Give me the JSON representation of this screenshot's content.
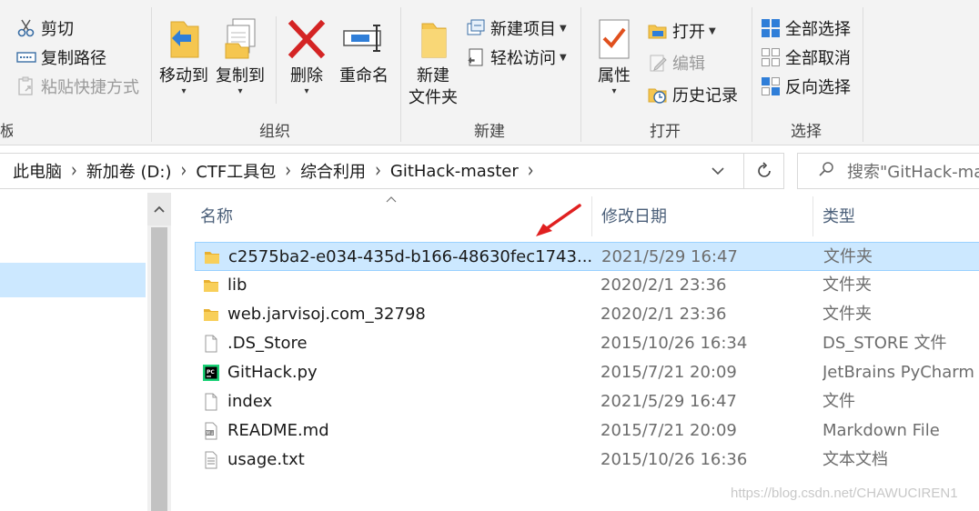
{
  "ribbon": {
    "clipboard_group": {
      "label_partial": "板",
      "cut": "剪切",
      "copy_path": "复制路径",
      "paste_shortcut": "粘贴快捷方式"
    },
    "organize_group": {
      "label": "组织",
      "move_to": "移动到",
      "copy_to": "复制到",
      "delete": "删除",
      "rename": "重命名"
    },
    "new_group": {
      "label": "新建",
      "new_folder_line1": "新建",
      "new_folder_line2": "文件夹",
      "new_item": "新建项目",
      "easy_access": "轻松访问"
    },
    "open_group": {
      "label": "打开",
      "properties": "属性",
      "open": "打开",
      "edit": "编辑",
      "history": "历史记录"
    },
    "select_group": {
      "label": "选择",
      "select_all": "全部选择",
      "select_none": "全部取消",
      "invert_selection": "反向选择"
    }
  },
  "address": {
    "crumbs": [
      "此电脑",
      "新加卷 (D:)",
      "CTF工具包",
      "综合利用",
      "GitHack-master"
    ],
    "search_placeholder": "搜索\"GitHack-master\""
  },
  "columns": {
    "name": "名称",
    "modified": "修改日期",
    "type": "类型"
  },
  "files": [
    {
      "name": "c2575ba2-e034-435d-b166-48630fec1743...",
      "date": "2021/5/29 16:47",
      "type": "文件夹",
      "icon": "folder-icon",
      "selected": true
    },
    {
      "name": "lib",
      "date": "2020/2/1 23:36",
      "type": "文件夹",
      "icon": "folder-icon"
    },
    {
      "name": "web.jarvisoj.com_32798",
      "date": "2020/2/1 23:36",
      "type": "文件夹",
      "icon": "folder-icon"
    },
    {
      "name": ".DS_Store",
      "date": "2015/10/26 16:34",
      "type": "DS_STORE 文件",
      "icon": "blank-file-icon"
    },
    {
      "name": "GitHack.py",
      "date": "2015/7/21 20:09",
      "type": "JetBrains PyCharm ...",
      "icon": "pycharm-file-icon"
    },
    {
      "name": "index",
      "date": "2021/5/29 16:47",
      "type": "文件",
      "icon": "blank-file-icon"
    },
    {
      "name": "README.md",
      "date": "2015/7/21 20:09",
      "type": "Markdown File",
      "icon": "markdown-file-icon"
    },
    {
      "name": "usage.txt",
      "date": "2015/10/26 16:36",
      "type": "文本文档",
      "icon": "text-file-icon"
    }
  ],
  "watermark": "https://blog.csdn.net/CHAWUCIREN1",
  "colors": {
    "selection": "#cce8ff",
    "selection_border": "#99d1ff",
    "annotation_arrow": "#e02020",
    "ribbon_bg": "#f3f3f3"
  }
}
